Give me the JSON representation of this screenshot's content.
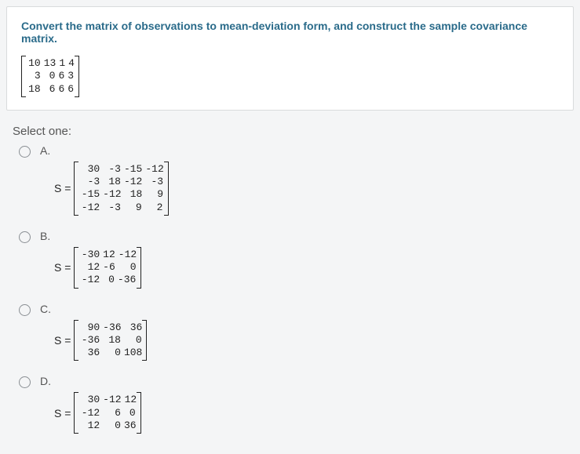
{
  "question": {
    "prompt": "Convert the matrix of observations to mean-deviation form, and construct the sample covariance matrix.",
    "matrix": [
      [
        "10",
        "13",
        "1",
        "4"
      ],
      [
        "3",
        "0",
        "6",
        "3"
      ],
      [
        "18",
        "6",
        "6",
        "6"
      ]
    ]
  },
  "select_label": "Select one:",
  "equals_prefix": "S =",
  "options": [
    {
      "letter": "A.",
      "matrix": [
        [
          "30",
          "-3",
          "-15",
          "-12"
        ],
        [
          "-3",
          "18",
          "-12",
          "-3"
        ],
        [
          "-15",
          "-12",
          "18",
          "9"
        ],
        [
          "-12",
          "-3",
          "9",
          "2"
        ]
      ]
    },
    {
      "letter": "B.",
      "matrix": [
        [
          "-30",
          "12",
          "-12"
        ],
        [
          "12",
          "-6",
          "0"
        ],
        [
          "-12",
          "0",
          "-36"
        ]
      ]
    },
    {
      "letter": "C.",
      "matrix": [
        [
          "90",
          "-36",
          "36"
        ],
        [
          "-36",
          "18",
          "0"
        ],
        [
          "36",
          "0",
          "108"
        ]
      ]
    },
    {
      "letter": "D.",
      "matrix": [
        [
          "30",
          "-12",
          "12"
        ],
        [
          "-12",
          "6",
          "0"
        ],
        [
          "12",
          "0",
          "36"
        ]
      ]
    }
  ]
}
